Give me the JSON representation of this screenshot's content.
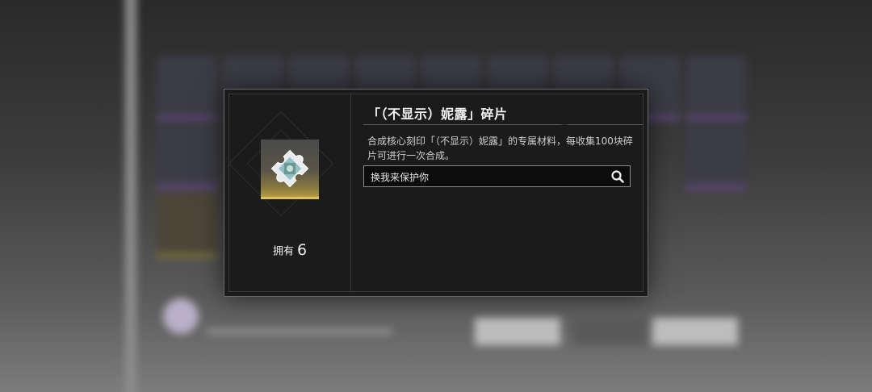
{
  "item": {
    "title": "「（不显示）妮露」碎片",
    "description": "合成核心刻印「（不显示）妮露」的专属材料，每收集100块碎片可进行一次合成。",
    "owned_label": "拥有",
    "owned_count": "6",
    "icon": "puzzle-fragment-icon"
  },
  "search": {
    "value": "换我来保护你",
    "icon": "search-icon"
  },
  "colors": {
    "modal_bg": "#1b1b1b",
    "rarity_gold": "#d8c060",
    "text": "#f2f2f2"
  }
}
